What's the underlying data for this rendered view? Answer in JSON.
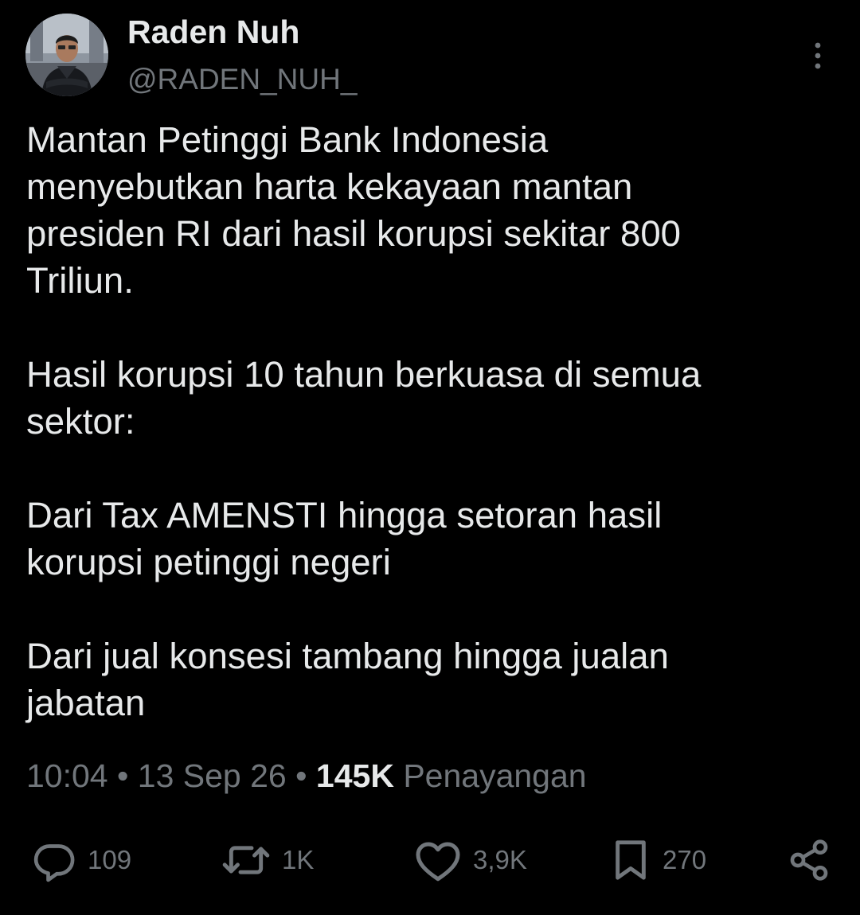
{
  "author": {
    "display_name": "Raden Nuh",
    "handle": "@RADEN_NUH_"
  },
  "tweet": {
    "paragraphs": [
      "Mantan Petinggi Bank Indonesia\nmenyebutkan harta kekayaan mantan\npresiden RI dari hasil korupsi sekitar 800\nTriliun.",
      "Hasil korupsi 10 tahun berkuasa di semua\nsektor:",
      "Dari Tax AMENSTI hingga setoran hasil\nkorupsi petinggi negeri",
      "Dari jual konsesi tambang hingga jualan\njabatan"
    ],
    "time": "10:04",
    "separator": "•",
    "date": "13 Sep 26",
    "views_count": "145K",
    "views_label": "Penayangan"
  },
  "actions": {
    "replies": "109",
    "reposts": "1K",
    "likes": "3,9K",
    "bookmarks": "270"
  },
  "icons": {
    "more": "more-vertical-icon",
    "reply": "reply-icon",
    "repost": "repost-icon",
    "like": "heart-icon",
    "bookmark": "bookmark-icon",
    "share": "share-icon"
  },
  "colors": {
    "background": "#000000",
    "text_primary": "#e7e9ea",
    "text_secondary": "#71767b"
  }
}
